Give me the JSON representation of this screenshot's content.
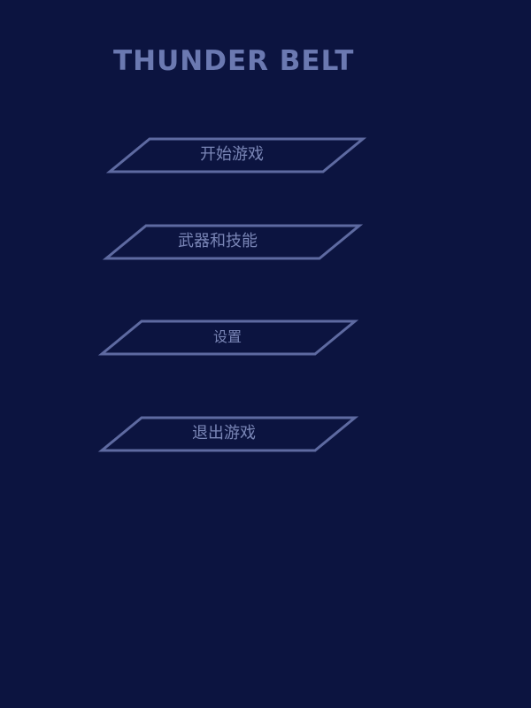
{
  "game": {
    "title": "THUNDER BELT"
  },
  "menu": {
    "items": [
      {
        "label": "开始游戏"
      },
      {
        "label": "武器和技能"
      },
      {
        "label": "设置"
      },
      {
        "label": "退出游戏"
      }
    ]
  },
  "colors": {
    "background": "#0c1440",
    "title": "#6b79b1",
    "button_outline": "#5e6aa1",
    "button_text": "#7a86b6"
  }
}
